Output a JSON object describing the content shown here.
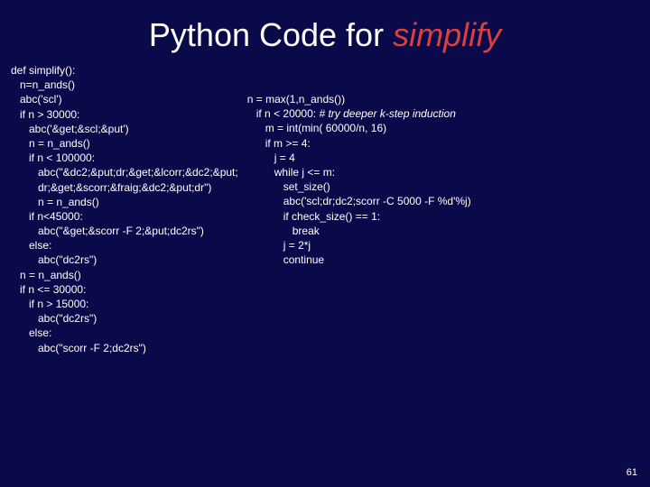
{
  "title": {
    "prefix": "Python Code for ",
    "emphasis": "simplify"
  },
  "left_col": "def simplify():\n   n=n_ands()\n   abc('scl')\n   if n > 30000:\n      abc('&get;&scl;&put')\n      n = n_ands()\n      if n < 100000:\n         abc(\"&dc2;&put;dr;&get;&lcorr;&dc2;&put;\n         dr;&get;&scorr;&fraig;&dc2;&put;dr\")\n         n = n_ands()\n      if n<45000:\n         abc(\"&get;&scorr -F 2;&put;dc2rs\")\n      else:\n         abc(\"dc2rs\")\n   n = n_ands()\n   if n <= 30000:\n      if n > 15000:\n         abc(\"dc2rs\")\n      else:\n         abc(\"scorr -F 2;dc2rs\")",
  "right_col_part1": "n = max(1,n_ands())\n   if n < 20000: ",
  "right_col_comment": "# try deeper k-step induction",
  "right_col_part2": "\n      m = int(min( 60000/n, 16)\n      if m >= 4:\n         j = 4\n         while j <= m:\n            set_size()\n            abc('scl;dr;dc2;scorr -C 5000 -F %d'%j)\n            if check_size() == 1:\n               break\n            j = 2*j\n            continue",
  "page_number": "61"
}
